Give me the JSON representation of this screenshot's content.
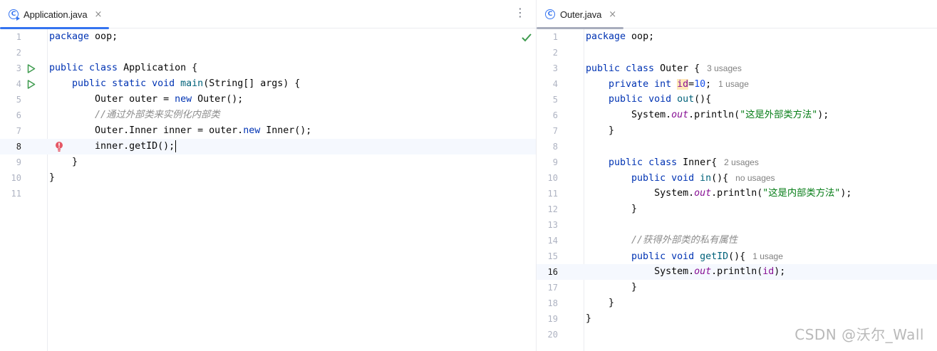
{
  "left": {
    "tab": {
      "label": "Application.java",
      "close": "×"
    },
    "menu": "⋮",
    "lines": [
      "1",
      "2",
      "3",
      "4",
      "5",
      "6",
      "7",
      "8",
      "9",
      "10",
      "11"
    ],
    "code": {
      "l1": {
        "kw": "package",
        "rest": " oop;"
      },
      "l3": {
        "kw": "public class",
        "rest": " Application {"
      },
      "l4": {
        "indent": "    ",
        "kw": "public static void",
        "sp": " ",
        "fn": "main",
        "rest": "(String[] args) {"
      },
      "l5": {
        "indent": "        ",
        "a": "Outer outer = ",
        "kw": "new",
        "b": " Outer();"
      },
      "l6": {
        "indent": "        ",
        "cm": "//通过外部类来实例化内部类"
      },
      "l7": {
        "indent": "        ",
        "a": "Outer.Inner inner = outer.",
        "kw": "new",
        "b": " Inner();"
      },
      "l8": {
        "indent": "        ",
        "a": "inner.getID();"
      },
      "l9": {
        "indent": "    ",
        "a": "}"
      },
      "l10": {
        "a": "}"
      }
    }
  },
  "right": {
    "tab": {
      "label": "Outer.java",
      "close": "×"
    },
    "lines": [
      "1",
      "2",
      "3",
      "4",
      "5",
      "6",
      "7",
      "8",
      "9",
      "10",
      "11",
      "12",
      "13",
      "14",
      "15",
      "16",
      "17",
      "18",
      "19",
      "20"
    ],
    "code": {
      "l1": {
        "kw": "package",
        "rest": " oop;"
      },
      "l3": {
        "kw": "public class",
        "rest": " Outer {",
        "hint": "3 usages"
      },
      "l4": {
        "indent": "    ",
        "kw": "private int",
        "sp": " ",
        "fld": "id",
        "eq": "=",
        "num": "10",
        "semi": ";",
        "hint": "1 usage"
      },
      "l5": {
        "indent": "    ",
        "kw": "public void",
        "sp": " ",
        "fn": "out",
        "rest": "(){"
      },
      "l6": {
        "indent": "        ",
        "a": "System.",
        "st": "out",
        "b": ".println(",
        "str": "\"这是外部类方法\"",
        "c": ");"
      },
      "l7": {
        "indent": "    ",
        "a": "}"
      },
      "l9": {
        "indent": "    ",
        "kw": "public class",
        "rest": " Inner{",
        "hint": "2 usages"
      },
      "l10": {
        "indent": "        ",
        "kw": "public void",
        "sp": " ",
        "fn": "in",
        "rest": "(){",
        "hint": "no usages"
      },
      "l11": {
        "indent": "            ",
        "a": "System.",
        "st": "out",
        "b": ".println(",
        "str": "\"这是内部类方法\"",
        "c": ");"
      },
      "l12": {
        "indent": "        ",
        "a": "}"
      },
      "l14": {
        "indent": "        ",
        "cm": "//获得外部类的私有属性"
      },
      "l15": {
        "indent": "        ",
        "kw": "public void",
        "sp": " ",
        "fn": "getID",
        "rest": "(){",
        "hint": "1 usage"
      },
      "l16": {
        "indent": "            ",
        "a": "System.",
        "st": "out",
        "b": ".println(",
        "fld": "id",
        "c": ");"
      },
      "l17": {
        "indent": "        ",
        "a": "}"
      },
      "l18": {
        "indent": "    ",
        "a": "}"
      },
      "l19": {
        "a": "}"
      }
    }
  },
  "watermark": "CSDN @沃尔_Wall",
  "colors": {
    "keyword": "#0033b3",
    "string": "#067d17",
    "comment": "#8c8c8c",
    "field": "#871094",
    "number": "#1750eb",
    "accent": "#3574f0"
  }
}
